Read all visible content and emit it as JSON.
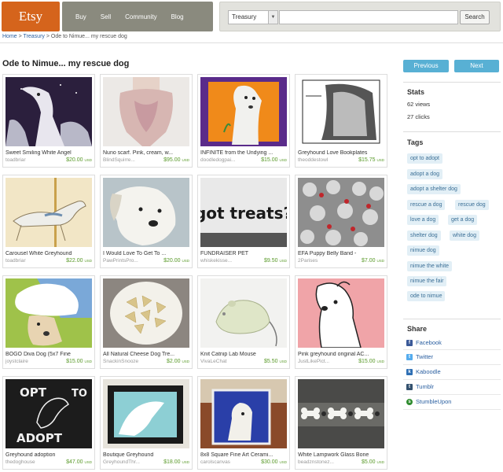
{
  "header": {
    "logo": "Etsy",
    "nav": [
      "Buy",
      "Sell",
      "Community",
      "Blog"
    ],
    "search": {
      "category": "Treasury",
      "button": "Search"
    }
  },
  "breadcrumb": {
    "home": "Home",
    "treasury": "Treasury",
    "current": "Ode to Nimue... my rescue dog"
  },
  "page_title": "Ode to Nimue... my rescue dog",
  "pager": {
    "prev": "Previous",
    "next": "Next"
  },
  "items": [
    {
      "title": "Sweet Smiling White Angel",
      "shop": "toadbriar",
      "price": "$20.00",
      "cur": "USD"
    },
    {
      "title": "Nuno scarf. Pink, cream, w...",
      "shop": "BlindSquirre...",
      "price": "$95.00",
      "cur": "USD"
    },
    {
      "title": "INFINITE from the Undying ...",
      "shop": "doodledogpai...",
      "price": "$15.00",
      "cur": "USD"
    },
    {
      "title": "Greyhound Love Bookplates",
      "shop": "theoddestowl",
      "price": "$15.75",
      "cur": "USD"
    },
    {
      "title": "Carousel White Greyhound",
      "shop": "toadbriar",
      "price": "$22.00",
      "cur": "USD"
    },
    {
      "title": "I Would Love To Get To ...",
      "shop": "PawPrintsPro...",
      "price": "$20.00",
      "cur": "USD"
    },
    {
      "title": "FUNDRAISER PET",
      "shop": "whiskekisse...",
      "price": "$9.50",
      "cur": "USD"
    },
    {
      "title": "EFA Puppy Belly Band -",
      "shop": "2Parises",
      "price": "$7.00",
      "cur": "USD"
    },
    {
      "title": "BOGO Diva Dog (5x7 Fine",
      "shop": "joystclaire",
      "price": "$15.00",
      "cur": "USD"
    },
    {
      "title": "All Natural Cheese Dog Tre...",
      "shop": "SnackinSnooze",
      "price": "$2.00",
      "cur": "USD"
    },
    {
      "title": "Knit Catnip Lab Mouse",
      "shop": "VivaLeChat",
      "price": "$5.50",
      "cur": "USD"
    },
    {
      "title": "Pink greyhound original AC...",
      "shop": "JustLikePict...",
      "price": "$15.00",
      "cur": "USD"
    },
    {
      "title": "Greyhound adoption",
      "shop": "thedoghouse",
      "price": "$47.00",
      "cur": "USD"
    },
    {
      "title": "Boutique Greyhound",
      "shop": "GreyhoundThr...",
      "price": "$18.00",
      "cur": "USD"
    },
    {
      "title": "8x8 Square Fine Art Cerami...",
      "shop": "carolscanvas",
      "price": "$30.00",
      "cur": "USD"
    },
    {
      "title": "White Lampwork Glass Bone",
      "shop": "beadznstonez...",
      "price": "$5.00",
      "cur": "USD"
    }
  ],
  "thumb_text": {
    "got_treats": "got treats?",
    "opt_left": "OPT",
    "opt_right": "TO",
    "adopt": "ADOPT"
  },
  "stats": {
    "heading": "Stats",
    "views": "62 views",
    "clicks": "27 clicks"
  },
  "tags_heading": "Tags",
  "tags": [
    "opt to adopt",
    "adopt a dog",
    "adopt a shelter dog",
    "rescue a dog",
    "rescue dog",
    "love a dog",
    "get a dog",
    "shelter dog",
    "white dog",
    "nimue dog",
    "nimue the white",
    "nimue the fair",
    "ode to nimue"
  ],
  "share": {
    "heading": "Share",
    "items": [
      {
        "label": "Facebook",
        "icon": "facebook-icon",
        "color": "#3b5998"
      },
      {
        "label": "Twitter",
        "icon": "twitter-icon",
        "color": "#55acee"
      },
      {
        "label": "Kaboodle",
        "icon": "kaboodle-icon",
        "color": "#2e6fb4"
      },
      {
        "label": "Tumblr",
        "icon": "tumblr-icon",
        "color": "#34526f"
      },
      {
        "label": "StumbleUpon",
        "icon": "stumbleupon-icon",
        "color": "#2e8b2e"
      }
    ]
  },
  "colors": {
    "logo": "#d5641c",
    "nav": "#8a8a7e",
    "button": "#58b0d4",
    "price": "#5a9a2a",
    "tag_bg": "#e2eff6"
  }
}
